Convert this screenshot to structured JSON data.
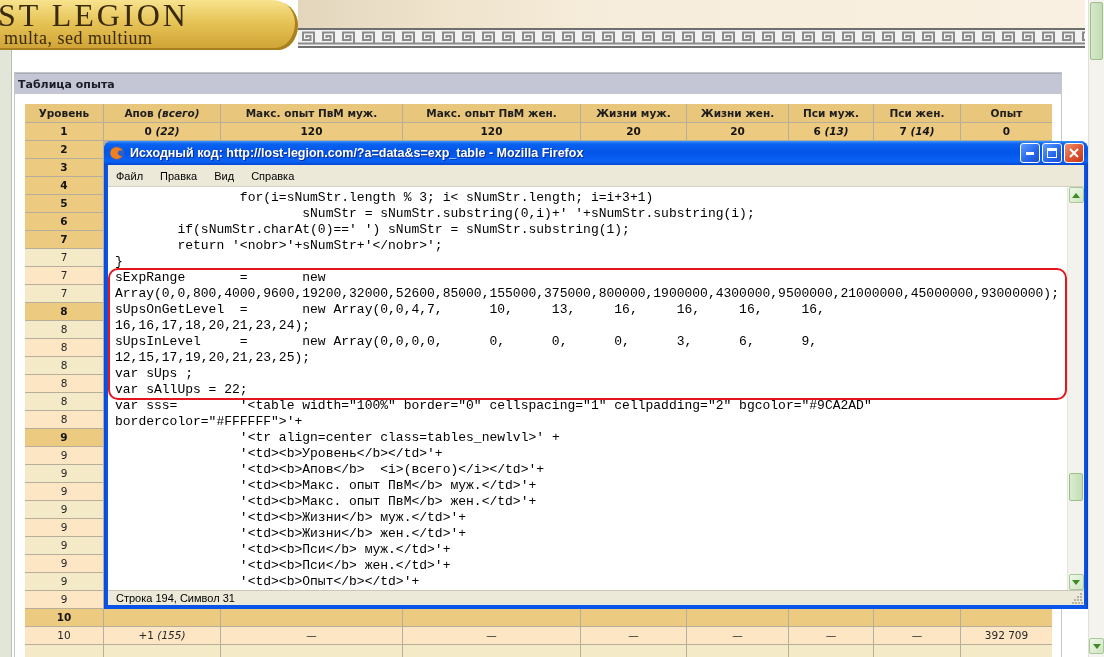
{
  "page_header": {
    "logo_title": "ST LEGION",
    "logo_motto": "multa, sed multium"
  },
  "panel": {
    "title": "Таблица опыта",
    "table": {
      "columns": [
        "Уровень",
        "Апов *(всего)*",
        "Макс. опыт ПвМ муж.",
        "Макс. опыт ПвМ жен.",
        "Жизни муж.",
        "Жизни жен.",
        "Пси муж.",
        "Пси жен.",
        "Опыт"
      ],
      "rows": [
        {
          "cells": [
            "1",
            "0 *(22)*",
            "120",
            "120",
            "20",
            "20",
            "6 *(13)*",
            "7 *(14)*",
            "0"
          ],
          "emphasized": true
        },
        {
          "cells": [
            "2"
          ],
          "emphasized": true
        },
        {
          "cells": [
            "3"
          ],
          "emphasized": true
        },
        {
          "cells": [
            "4"
          ],
          "emphasized": true
        },
        {
          "cells": [
            "5"
          ],
          "emphasized": true
        },
        {
          "cells": [
            "6"
          ],
          "emphasized": true
        },
        {
          "cells": [
            "7"
          ],
          "emphasized": true
        },
        {
          "cells": [
            "7"
          ],
          "emphasized": false
        },
        {
          "cells": [
            "7"
          ],
          "emphasized": false
        },
        {
          "cells": [
            "7"
          ],
          "emphasized": false
        },
        {
          "cells": [
            "8"
          ],
          "emphasized": true
        },
        {
          "cells": [
            "8"
          ],
          "emphasized": false
        },
        {
          "cells": [
            "8"
          ],
          "emphasized": false
        },
        {
          "cells": [
            "8"
          ],
          "emphasized": false
        },
        {
          "cells": [
            "8"
          ],
          "emphasized": false
        },
        {
          "cells": [
            "8"
          ],
          "emphasized": false
        },
        {
          "cells": [
            "8"
          ],
          "emphasized": false
        },
        {
          "cells": [
            "9"
          ],
          "emphasized": true
        },
        {
          "cells": [
            "9"
          ],
          "emphasized": false
        },
        {
          "cells": [
            "9"
          ],
          "emphasized": false
        },
        {
          "cells": [
            "9"
          ],
          "emphasized": false
        },
        {
          "cells": [
            "9"
          ],
          "emphasized": false
        },
        {
          "cells": [
            "9"
          ],
          "emphasized": false
        },
        {
          "cells": [
            "9"
          ],
          "emphasized": false
        },
        {
          "cells": [
            "9"
          ],
          "emphasized": false
        },
        {
          "cells": [
            "9"
          ],
          "emphasized": false
        },
        {
          "cells": [
            "9"
          ],
          "emphasized": false
        },
        {
          "cells": [
            "10",
            null,
            null,
            null,
            null,
            null,
            null,
            null,
            null
          ],
          "emphasized": true
        },
        {
          "cells": [
            "10",
            "+1 *(155)*",
            "—",
            "—",
            "—",
            "—",
            "—",
            "—",
            "392 709"
          ],
          "emphasized": false
        },
        {
          "cells": [
            null,
            null,
            null,
            null,
            null,
            null,
            null,
            null,
            null
          ],
          "emphasized": false
        }
      ]
    }
  },
  "source_window": {
    "title": "Исходный код: http://lost-legion.com/?a=data&s=exp_table - Mozilla Firefox",
    "menu": [
      "Файл",
      "Правка",
      "Вид",
      "Справка"
    ],
    "code_blocks": [
      {
        "kind": "plain",
        "lines": [
          "                for(i=sNumStr.length % 3; i< sNumStr.length; i=i+3+1)",
          "                        sNumStr = sNumStr.substring(0,i)+' '+sNumStr.substring(i);",
          "        if(sNumStr.charAt(0)==' ') sNumStr = sNumStr.substring(1);",
          "        return '<nobr>'+sNumStr+'</nobr>';",
          "}"
        ]
      },
      {
        "kind": "framed",
        "lines": [
          "sExpRange       =       new",
          "Array(0,0,800,4000,9600,19200,32000,52600,85000,155000,375000,800000,1900000,4300000,9500000,21000000,45000000,93000000);",
          "sUpsOnGetLevel  =       new Array(0,0,4,7,      10,     13,     16,     16,     16,     16,",
          "16,16,17,18,20,21,23,24);",
          "sUpsInLevel     =       new Array(0,0,0,0,      0,      0,      0,      3,      6,      9,",
          "12,15,17,19,20,21,23,25);",
          "var sUps ;",
          "var sAllUps = 22;"
        ]
      },
      {
        "kind": "plain",
        "lines": [
          "var sss=        '<table width=\"100%\" border=\"0\" cellspacing=\"1\" cellpadding=\"2\" bgcolor=\"#9CA2AD\"",
          "bordercolor=\"#FFFFFF\">'+",
          "                '<tr align=center class=tables_newlvl>' +",
          "                '<td><b>Уровень</b></td>'+",
          "                '<td><b>Апов</b>  <i>(всего)</i></td>'+",
          "                '<td><b>Макс. опыт ПвМ</b> муж.</td>'+",
          "                '<td><b>Макс. опыт ПвМ</b> жен.</td>'+",
          "                '<td><b>Жизни</b> муж.</td>'+",
          "                '<td><b>Жизни</b> жен.</td>'+",
          "                '<td><b>Пси</b> муж.</td>'+",
          "                '<td><b>Пси</b> жен.</td>'+",
          "                '<td><b>Опыт</b></td>'+"
        ]
      }
    ],
    "status": "Строка 194, Символ 31"
  }
}
